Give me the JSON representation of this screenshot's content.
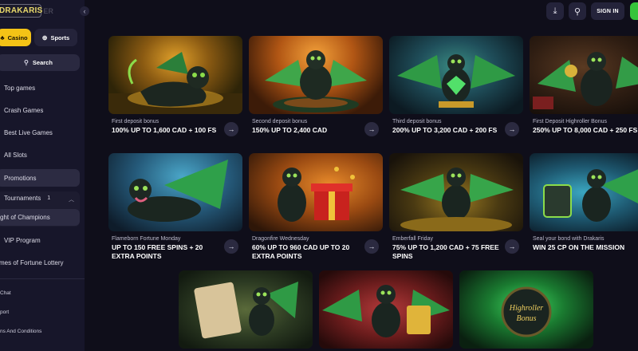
{
  "brand": {
    "name": "DRAKARIS",
    "suffix": "ER"
  },
  "sidebar": {
    "collapse_icon": "chevron-left-icon",
    "tabs": [
      {
        "label": "Casino",
        "icon": "casino-icon"
      },
      {
        "label": "Sports",
        "icon": "soccer-ball-icon"
      }
    ],
    "search_label": "Search",
    "nav": [
      {
        "label": "Top games"
      },
      {
        "label": "Crash Games"
      },
      {
        "label": "Best Live Games"
      },
      {
        "label": "All Slots"
      },
      {
        "label": "Promotions"
      },
      {
        "label": "Tournaments"
      },
      {
        "label": "ght of Champions"
      },
      {
        "label": "VIP Program"
      },
      {
        "label": "mes of Fortune Lottery"
      }
    ],
    "tournaments_count": "1",
    "links": [
      {
        "label": "Chat"
      },
      {
        "label": "port"
      },
      {
        "label": "ns And Conditions"
      }
    ]
  },
  "header": {
    "download_icon": "download-icon",
    "search_icon": "search-icon",
    "signin_label": "SIGN IN",
    "accent": "#37c43a"
  },
  "promotions": [
    {
      "caption": "First deposit bonus",
      "title": "100% UP TO 1,600 CAD + 100 FS"
    },
    {
      "caption": "Second deposit bonus",
      "title": "150% UP TO 2,400 CAD"
    },
    {
      "caption": "Third deposit bonus",
      "title": "200% UP TO 3,200 CAD + 200 FS"
    },
    {
      "caption": "First Deposit Highroller Bonus",
      "title": "250% UP TO 8,000 CAD + 250 FS"
    },
    {
      "caption": "Flameborn Fortune Monday",
      "title": "UP TO 150 FREE SPINS + 20 EXTRA POINTS"
    },
    {
      "caption": "Dragonfire Wednesday",
      "title": "60% UP TO 960 CAD UP TO 20 EXTRA POINTS"
    },
    {
      "caption": "Emberfall Friday",
      "title": "75% UP TO 1,200 CAD + 75 FREE SPINS"
    },
    {
      "caption": "Seal your bond with Drakaris",
      "title": "WIN 25 CP ON THE MISSION"
    }
  ],
  "highroller_badge": {
    "line1": "Highroller",
    "line2": "Bonus"
  },
  "colors": {
    "background": "#0f0e1a",
    "sidebar": "#17162a",
    "casino_tab": "#f4c316"
  }
}
